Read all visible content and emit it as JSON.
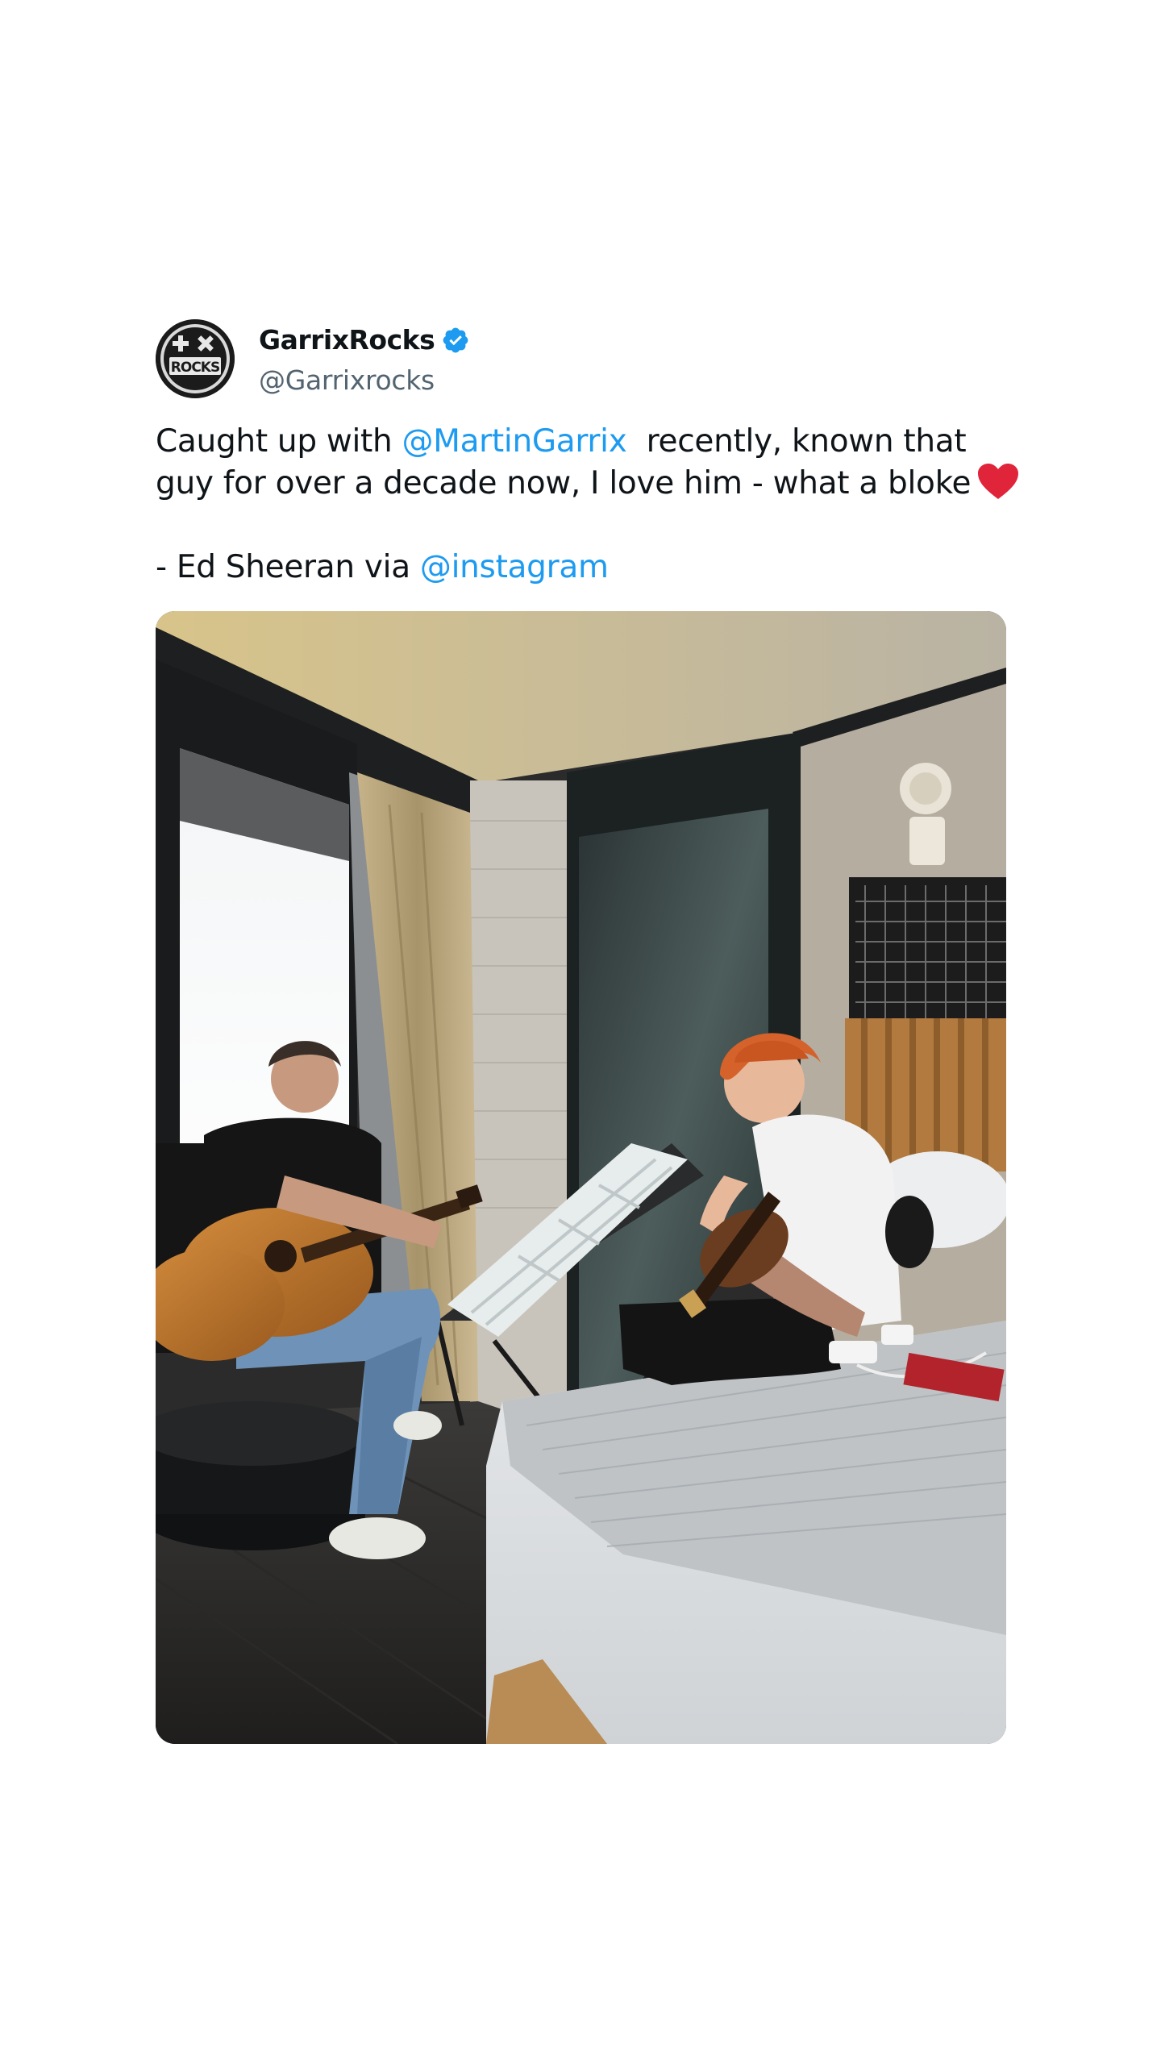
{
  "tweet": {
    "author": {
      "display_name": "GarrixRocks",
      "handle": "@Garrixrocks",
      "avatar_icon": "garrixrocks-logo",
      "verified_icon": "verified-badge-icon",
      "verified_color": "#1d9bf0"
    },
    "text": {
      "line1_prefix": "Caught up with ",
      "line1_mention": "@MartinGarrix",
      "line1_suffix": "  recently, known that",
      "line2": "guy for over a decade now, I love him - what a bloke",
      "line2_emoji": "red-heart-icon",
      "line3_prefix": "- Ed Sheeran via ",
      "line3_mention": "@instagram"
    },
    "media": {
      "type": "photo",
      "icon": "photo-two-men-playing-guitars-in-hotel-room"
    },
    "colors": {
      "mention": "#1d9bf0",
      "text": "#0f1419",
      "handle": "#536471",
      "heart": "#e0243a"
    }
  }
}
